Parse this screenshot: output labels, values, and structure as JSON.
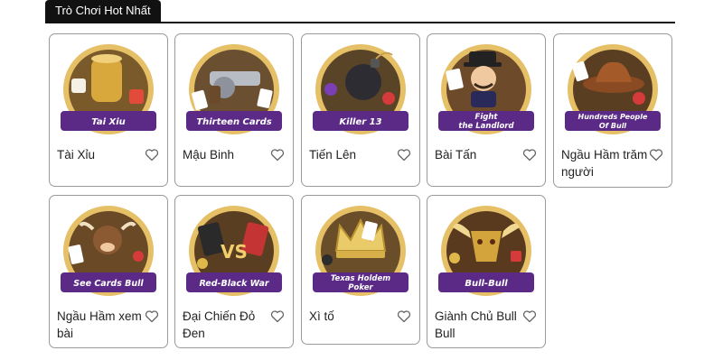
{
  "section": {
    "tab_label": "Trò Chơi Hot Nhất"
  },
  "games": [
    {
      "name": "Tài Xỉu",
      "banner": [
        "Tai Xiu"
      ],
      "art_icon": "dice-shaker-icon",
      "theme": "#d9b04a"
    },
    {
      "name": "Mậu Binh",
      "banner": [
        "Thirteen Cards"
      ],
      "art_icon": "revolver-icon",
      "theme": "#c9a040"
    },
    {
      "name": "Tiến Lên",
      "banner": [
        "Killer 13"
      ],
      "art_icon": "bomb-icon",
      "theme": "#b88a3a"
    },
    {
      "name": "Bài Tấn",
      "banner": [
        "Fight",
        "the Landlord"
      ],
      "art_icon": "landlord-icon",
      "theme": "#c99a44"
    },
    {
      "name": "Ngầu Hầm trăm người",
      "banner": [
        "Hundreds People",
        "Of Bull"
      ],
      "art_icon": "cowboy-hat-icon",
      "theme": "#b8863a"
    },
    {
      "name": "Ngầu Hầm xem bài",
      "banner": [
        "See Cards Bull"
      ],
      "art_icon": "bull-icon",
      "theme": "#c9963e"
    },
    {
      "name": "Đại Chiến Đỏ Đen",
      "banner": [
        "Red-Black War"
      ],
      "art_icon": "versus-icon",
      "theme": "#b07a34"
    },
    {
      "name": "Xì tố",
      "banner": [
        "Texas Holdem",
        "Poker"
      ],
      "art_icon": "crown-icon",
      "theme": "#c39a46"
    },
    {
      "name": "Giành Chủ Bull Bull",
      "banner": [
        "Bull-Bull"
      ],
      "art_icon": "bull-head-icon",
      "theme": "#a8742e"
    }
  ],
  "colors": {
    "banner_purple": "#5a2a86",
    "ring_gold": "#d4a84a",
    "card_border": "#9a9a9a"
  }
}
